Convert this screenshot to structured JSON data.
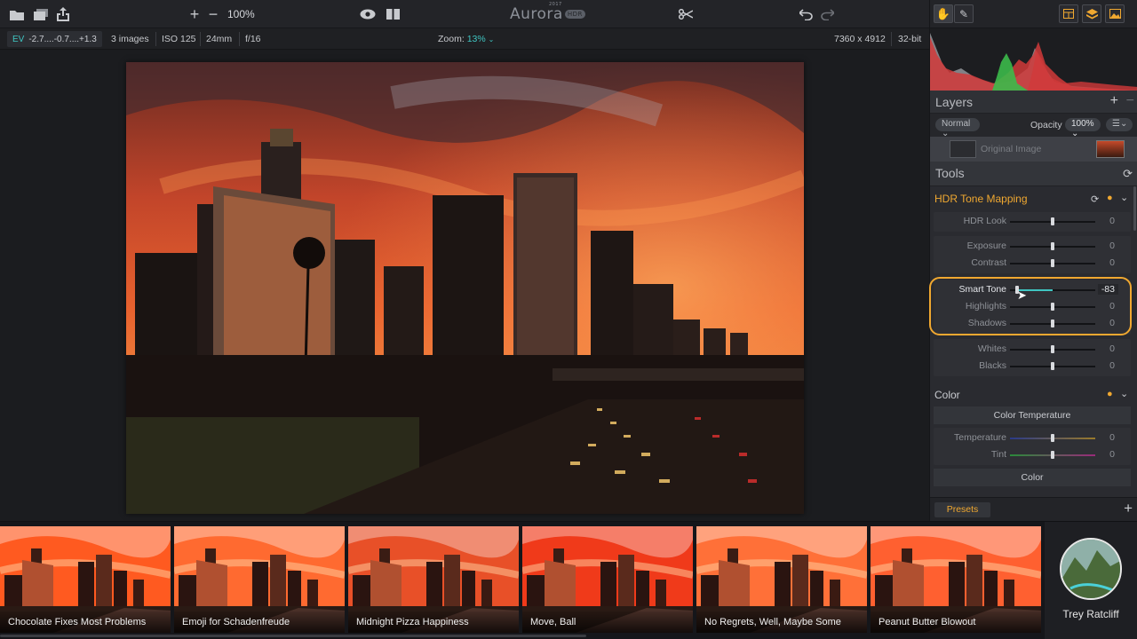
{
  "toolbar": {
    "zoom_percent": "100%",
    "logo": "Aurora",
    "logo_year": "2017",
    "logo_tag": "HDR"
  },
  "infobar": {
    "ev_label": "EV",
    "ev_values": "-2.7....-0.7....+1.3",
    "images": "3 images",
    "iso": "ISO 125",
    "focal": "24mm",
    "aperture": "f/16",
    "zoom_label": "Zoom:",
    "zoom_value": "13%",
    "dimensions": "7360 x 4912",
    "bitdepth": "32-bit"
  },
  "layers": {
    "title": "Layers",
    "add": "+",
    "remove": "−",
    "blend_mode": "Normal",
    "opacity_label": "Opacity",
    "opacity_value": "100%",
    "layer_name": "Original Image"
  },
  "tools": {
    "title": "Tools"
  },
  "hdr": {
    "title": "HDR Tone Mapping",
    "sliders": [
      {
        "label": "HDR Look",
        "value": "0",
        "pos": 0.5
      },
      {
        "label": "Exposure",
        "value": "0",
        "pos": 0.5
      },
      {
        "label": "Contrast",
        "value": "0",
        "pos": 0.5
      },
      {
        "label": "Smart Tone",
        "value": "-83",
        "pos": 0.085
      },
      {
        "label": "Highlights",
        "value": "0",
        "pos": 0.5
      },
      {
        "label": "Shadows",
        "value": "0",
        "pos": 0.5
      },
      {
        "label": "Whites",
        "value": "0",
        "pos": 0.5
      },
      {
        "label": "Blacks",
        "value": "0",
        "pos": 0.5
      }
    ]
  },
  "color": {
    "title": "Color",
    "temp_button": "Color Temperature",
    "sliders": [
      {
        "label": "Temperature",
        "value": "0",
        "pos": 0.5
      },
      {
        "label": "Tint",
        "value": "0",
        "pos": 0.5
      }
    ],
    "color_button": "Color"
  },
  "presets": {
    "button": "Presets",
    "add": "+"
  },
  "filmstrip": {
    "items": [
      "Chocolate Fixes Most Problems",
      "Emoji for Schadenfreude",
      "Midnight Pizza Happiness",
      "Move, Ball",
      "No Regrets, Well, Maybe Some",
      "Peanut Butter Blowout"
    ],
    "author": "Trey Ratcliff"
  },
  "colors": {
    "accent_teal": "#3fc5c2",
    "accent_orange": "#f0a830"
  }
}
